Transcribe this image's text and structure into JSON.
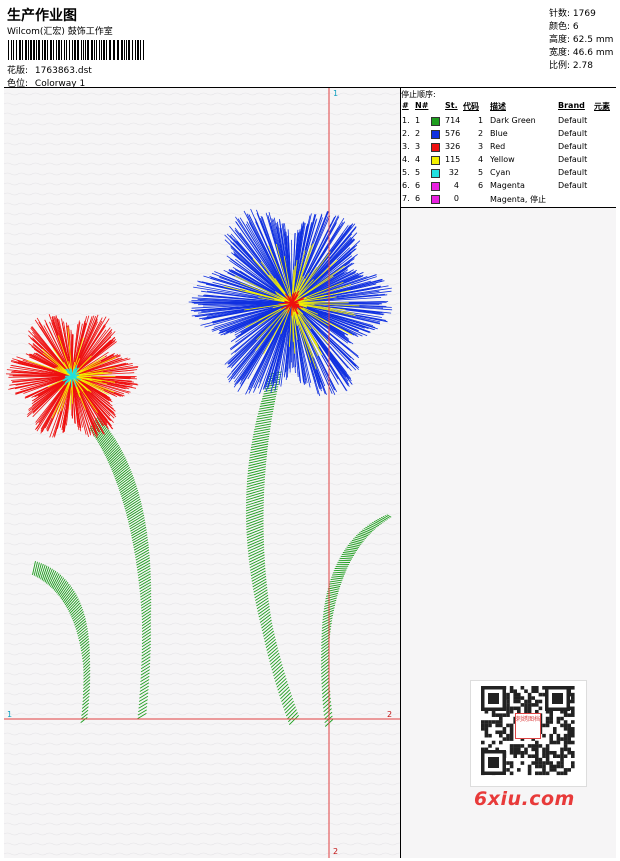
{
  "header": {
    "title": "生产作业图",
    "company": "Wilcom(汇宏) 鼓饰工作室",
    "design_label": "花版:",
    "design_value": "1763863.dst",
    "colorway_label": "色位:",
    "colorway_value": "Colorway 1"
  },
  "stats": {
    "stitches_label": "针数:",
    "stitches_value": "1769",
    "colors_label": "颜色:",
    "colors_value": "6",
    "height_label": "高度:",
    "height_value": "62.5 mm",
    "width_label": "宽度:",
    "width_value": "46.6 mm",
    "ratio_label": "比例:",
    "ratio_value": "2.78"
  },
  "stop_panel": {
    "title": "停止顺序:",
    "headers": {
      "num": "#",
      "n": "N#",
      "st": "St.",
      "code": "代码",
      "desc": "描述",
      "brand": "Brand",
      "element": "元素"
    },
    "rows": [
      {
        "num": "1.",
        "n": "1",
        "color": "#1e9e1e",
        "st": "714",
        "code": "1",
        "desc": "Dark Green",
        "brand": "Default"
      },
      {
        "num": "2.",
        "n": "2",
        "color": "#1030e0",
        "st": "576",
        "code": "2",
        "desc": "Blue",
        "brand": "Default"
      },
      {
        "num": "3.",
        "n": "3",
        "color": "#ee1010",
        "st": "326",
        "code": "3",
        "desc": "Red",
        "brand": "Default"
      },
      {
        "num": "4.",
        "n": "4",
        "color": "#f4f000",
        "st": "115",
        "code": "4",
        "desc": "Yellow",
        "brand": "Default"
      },
      {
        "num": "5.",
        "n": "5",
        "color": "#20e0e0",
        "st": "32",
        "code": "5",
        "desc": "Cyan",
        "brand": "Default"
      },
      {
        "num": "6.",
        "n": "6",
        "color": "#e820e0",
        "st": "4",
        "code": "6",
        "desc": "Magenta",
        "brand": "Default"
      },
      {
        "num": "7.",
        "n": "6",
        "color": "#e820e0",
        "st": "0",
        "code": "",
        "desc": "Magenta, 停止",
        "brand": ""
      }
    ]
  },
  "axes": {
    "top": "1",
    "left": "1",
    "right": "2",
    "bottom": "2"
  },
  "watermark": {
    "text": "6xiu.com",
    "qr_label": "刺绣图档"
  }
}
